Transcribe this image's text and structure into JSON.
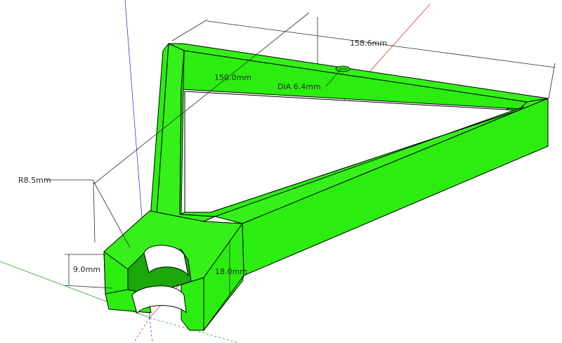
{
  "model": {
    "face_color": "#2bee10",
    "top_color": "#35f019",
    "dark_color": "#1aa80a",
    "edge_color": "#000000"
  },
  "axes": {
    "red_color": "#d13a3a",
    "green_color": "#2f9e2f",
    "blue_color": "#3b3bd6"
  },
  "dimensions": {
    "overall_length": "158.6mm",
    "arm_length": "150.0mm",
    "hole_diameter": "DIA 6.4mm",
    "hub_radius": "R8.5mm",
    "slot_depth": "9.0mm",
    "thickness": "18.0mm"
  }
}
